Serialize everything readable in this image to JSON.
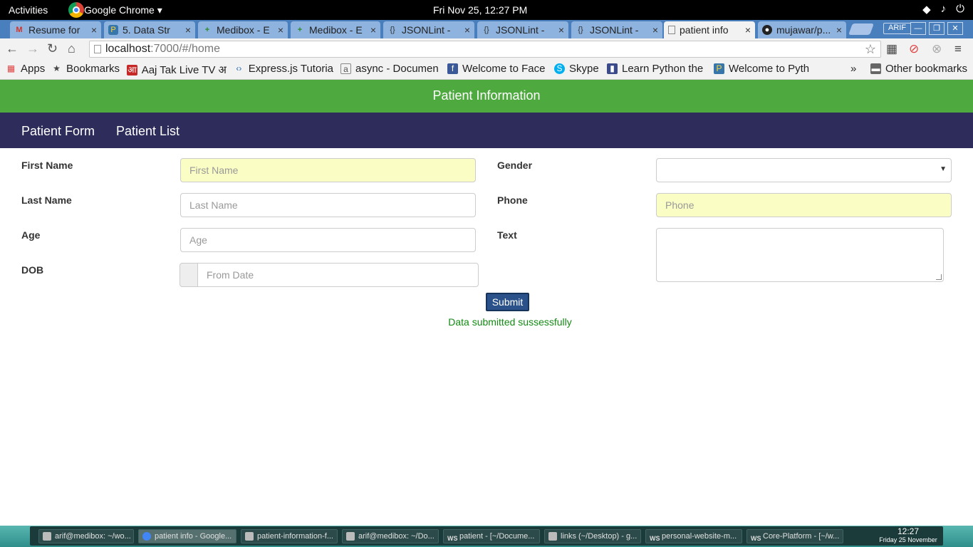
{
  "topbar": {
    "activities": "Activities",
    "app_name": "Google Chrome ▾",
    "clock": "Fri Nov 25, 12:27 PM"
  },
  "tabs": [
    {
      "title": "Resume for",
      "icon": "gmail-icon"
    },
    {
      "title": "5. Data Str",
      "icon": "python-icon"
    },
    {
      "title": "Medibox - E",
      "icon": "medibox-icon"
    },
    {
      "title": "Medibox - E",
      "icon": "medibox-icon"
    },
    {
      "title": "JSONLint -",
      "icon": "json-icon"
    },
    {
      "title": "JSONLint -",
      "icon": "json-icon"
    },
    {
      "title": "JSONLint -",
      "icon": "json-icon"
    },
    {
      "title": "patient info",
      "icon": "page-icon"
    },
    {
      "title": "mujawar/p...",
      "icon": "github-icon"
    }
  ],
  "profile": "ARIF",
  "address": {
    "host": "localhost",
    "path": ":7000/#/home"
  },
  "bookmarks": [
    {
      "label": "Apps"
    },
    {
      "label": "Bookmarks"
    },
    {
      "label": "Aaj Tak Live TV अ"
    },
    {
      "label": "Express.js Tutoria"
    },
    {
      "label": "async - Documen"
    },
    {
      "label": "Welcome to Face"
    },
    {
      "label": "Skype"
    },
    {
      "label": "Learn Python the"
    },
    {
      "label": "Welcome to Pyth"
    },
    {
      "label": "»"
    },
    {
      "label": "Other bookmarks"
    }
  ],
  "app": {
    "header_title": "Patient Information",
    "nav": {
      "form": "Patient Form",
      "list": "Patient List"
    },
    "form": {
      "first_name_label": "First Name",
      "first_name_placeholder": "First Name",
      "last_name_label": "Last Name",
      "last_name_placeholder": "Last Name",
      "age_label": "Age",
      "age_placeholder": "Age",
      "dob_label": "DOB",
      "dob_placeholder": "From Date",
      "gender_label": "Gender",
      "gender_value": "",
      "phone_label": "Phone",
      "phone_placeholder": "Phone",
      "text_label": "Text",
      "submit": "Submit",
      "message": "Data submitted sussessfully"
    },
    "colors": {
      "header": "#4ea93f",
      "nav": "#2e2c5a",
      "autofill": "#fafdc4",
      "success": "#138a13"
    }
  },
  "taskbar": {
    "items": [
      {
        "label": "arif@medibox: ~/wo..."
      },
      {
        "label": "patient info - Google..."
      },
      {
        "label": "patient-information-f..."
      },
      {
        "label": "arif@medibox: ~/Do..."
      },
      {
        "label": "patient - [~/Docume..."
      },
      {
        "label": "links (~/Desktop) - g..."
      },
      {
        "label": "personal-website-m..."
      },
      {
        "label": "Core-Platform - [~/w..."
      }
    ],
    "clock_time": "12:27",
    "clock_date": "Friday 25 November"
  }
}
